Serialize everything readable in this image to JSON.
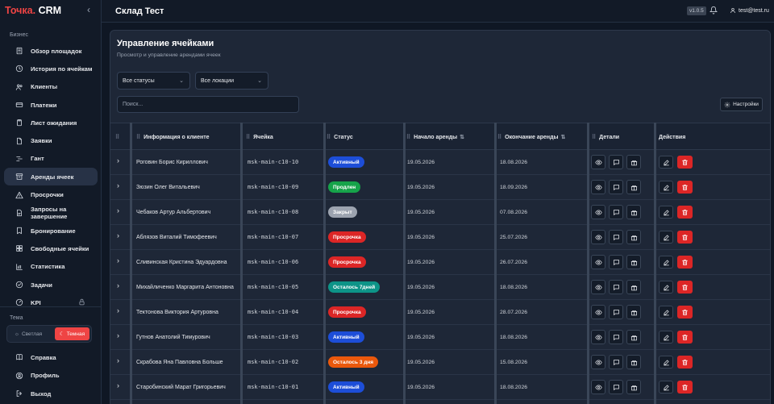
{
  "app": {
    "brand_part1": "Точка.",
    "brand_part2": " CRM"
  },
  "sidebar": {
    "section_label": "Бизнес",
    "items": [
      {
        "label": "Обзор площадок",
        "icon": "building-icon"
      },
      {
        "label": "История по ячейкам",
        "icon": "history-icon"
      },
      {
        "label": "Клиенты",
        "icon": "users-icon"
      },
      {
        "label": "Платежи",
        "icon": "credit-card-icon"
      },
      {
        "label": "Лист ожидания",
        "icon": "clipboard-icon"
      },
      {
        "label": "Заявки",
        "icon": "file-icon"
      },
      {
        "label": "Гант",
        "icon": "gantt-icon"
      },
      {
        "label": "Аренды ячеек",
        "icon": "archive-icon",
        "active": true
      },
      {
        "label": "Просрочки",
        "icon": "alert-triangle-icon"
      },
      {
        "label": "Запросы на завершение",
        "icon": "file-request-icon"
      },
      {
        "label": "Бронирование",
        "icon": "bookmark-icon"
      },
      {
        "label": "Свободные ячейки",
        "icon": "grid-icon"
      },
      {
        "label": "Статистика",
        "icon": "chart-icon"
      },
      {
        "label": "Задачи",
        "icon": "check-circle-icon"
      },
      {
        "label": "KPI",
        "icon": "kpi-icon",
        "locked": true
      }
    ],
    "theme_label": "Тема",
    "theme_light": "Светлая",
    "theme_dark": "Темная",
    "bottom_items": [
      {
        "label": "Справка",
        "icon": "book-icon"
      },
      {
        "label": "Профиль",
        "icon": "user-circle-icon"
      },
      {
        "label": "Выход",
        "icon": "logout-icon"
      }
    ]
  },
  "header": {
    "title": "Склад Тест",
    "version": "v1.0.5",
    "user_email": "test@test.ru"
  },
  "page": {
    "title": "Управление ячейками",
    "subtitle": "Просмотр и управление арендами ячеек",
    "filter_status": "Все статусы",
    "filter_location": "Все локации",
    "search_placeholder": "Поиск...",
    "settings_label": "Настройки"
  },
  "table": {
    "columns": [
      "Информация о клиенте",
      "Ячейка",
      "Статус",
      "Начало аренды",
      "Окончание аренды",
      "Детали",
      "Действия"
    ],
    "rows": [
      {
        "client": "Роговин Борис Кириллович",
        "cell": "msk-main-c10-10",
        "status": "Активный",
        "start": "19.05.2026",
        "end": "18.08.2026"
      },
      {
        "client": "Зюзин Олег Витальевич",
        "cell": "msk-main-c10-09",
        "status": "Продлен",
        "start": "19.05.2026",
        "end": "18.09.2026"
      },
      {
        "client": "Чебаков Артур Альбертович",
        "cell": "msk-main-c10-08",
        "status": "Закрыт",
        "start": "19.05.2026",
        "end": "07.08.2026"
      },
      {
        "client": "Аблязов Виталий Тимофеевич",
        "cell": "msk-main-c10-07",
        "status": "Просрочка",
        "start": "19.05.2026",
        "end": "25.07.2026"
      },
      {
        "client": "Сливинская Кристина Эдуардовна",
        "cell": "msk-main-c10-06",
        "status": "Просрочка",
        "start": "19.05.2026",
        "end": "26.07.2026"
      },
      {
        "client": "Михайличенко Маргарита Антоновна",
        "cell": "msk-main-c10-05",
        "status": "Осталось 7дней",
        "start": "19.05.2026",
        "end": "18.08.2026"
      },
      {
        "client": "Тектонова Виктория Артуровна",
        "cell": "msk-main-c10-04",
        "status": "Просрочка",
        "start": "19.05.2026",
        "end": "28.07.2026"
      },
      {
        "client": "Гутнов Анатолий Тимурович",
        "cell": "msk-main-c10-03",
        "status": "Активный",
        "start": "19.05.2026",
        "end": "18.08.2026"
      },
      {
        "client": "Скрабова Яна Павловна Больше",
        "cell": "msk-main-c10-02",
        "status": "Осталось 3 дня",
        "start": "19.05.2026",
        "end": "15.08.2026"
      },
      {
        "client": "Старобинский Марат Григорьевич",
        "cell": "msk-main-c10-01",
        "status": "Активный",
        "start": "19.05.2026",
        "end": "18.08.2026"
      }
    ]
  },
  "status_colors": {
    "Активный": "#1d4ed8",
    "Продлен": "#16a34a",
    "Закрыт": "#9ca3af",
    "Просрочка": "#dc2626",
    "Осталось 7дней": "#0d9488",
    "Осталось 3 дня": "#ea580c"
  }
}
